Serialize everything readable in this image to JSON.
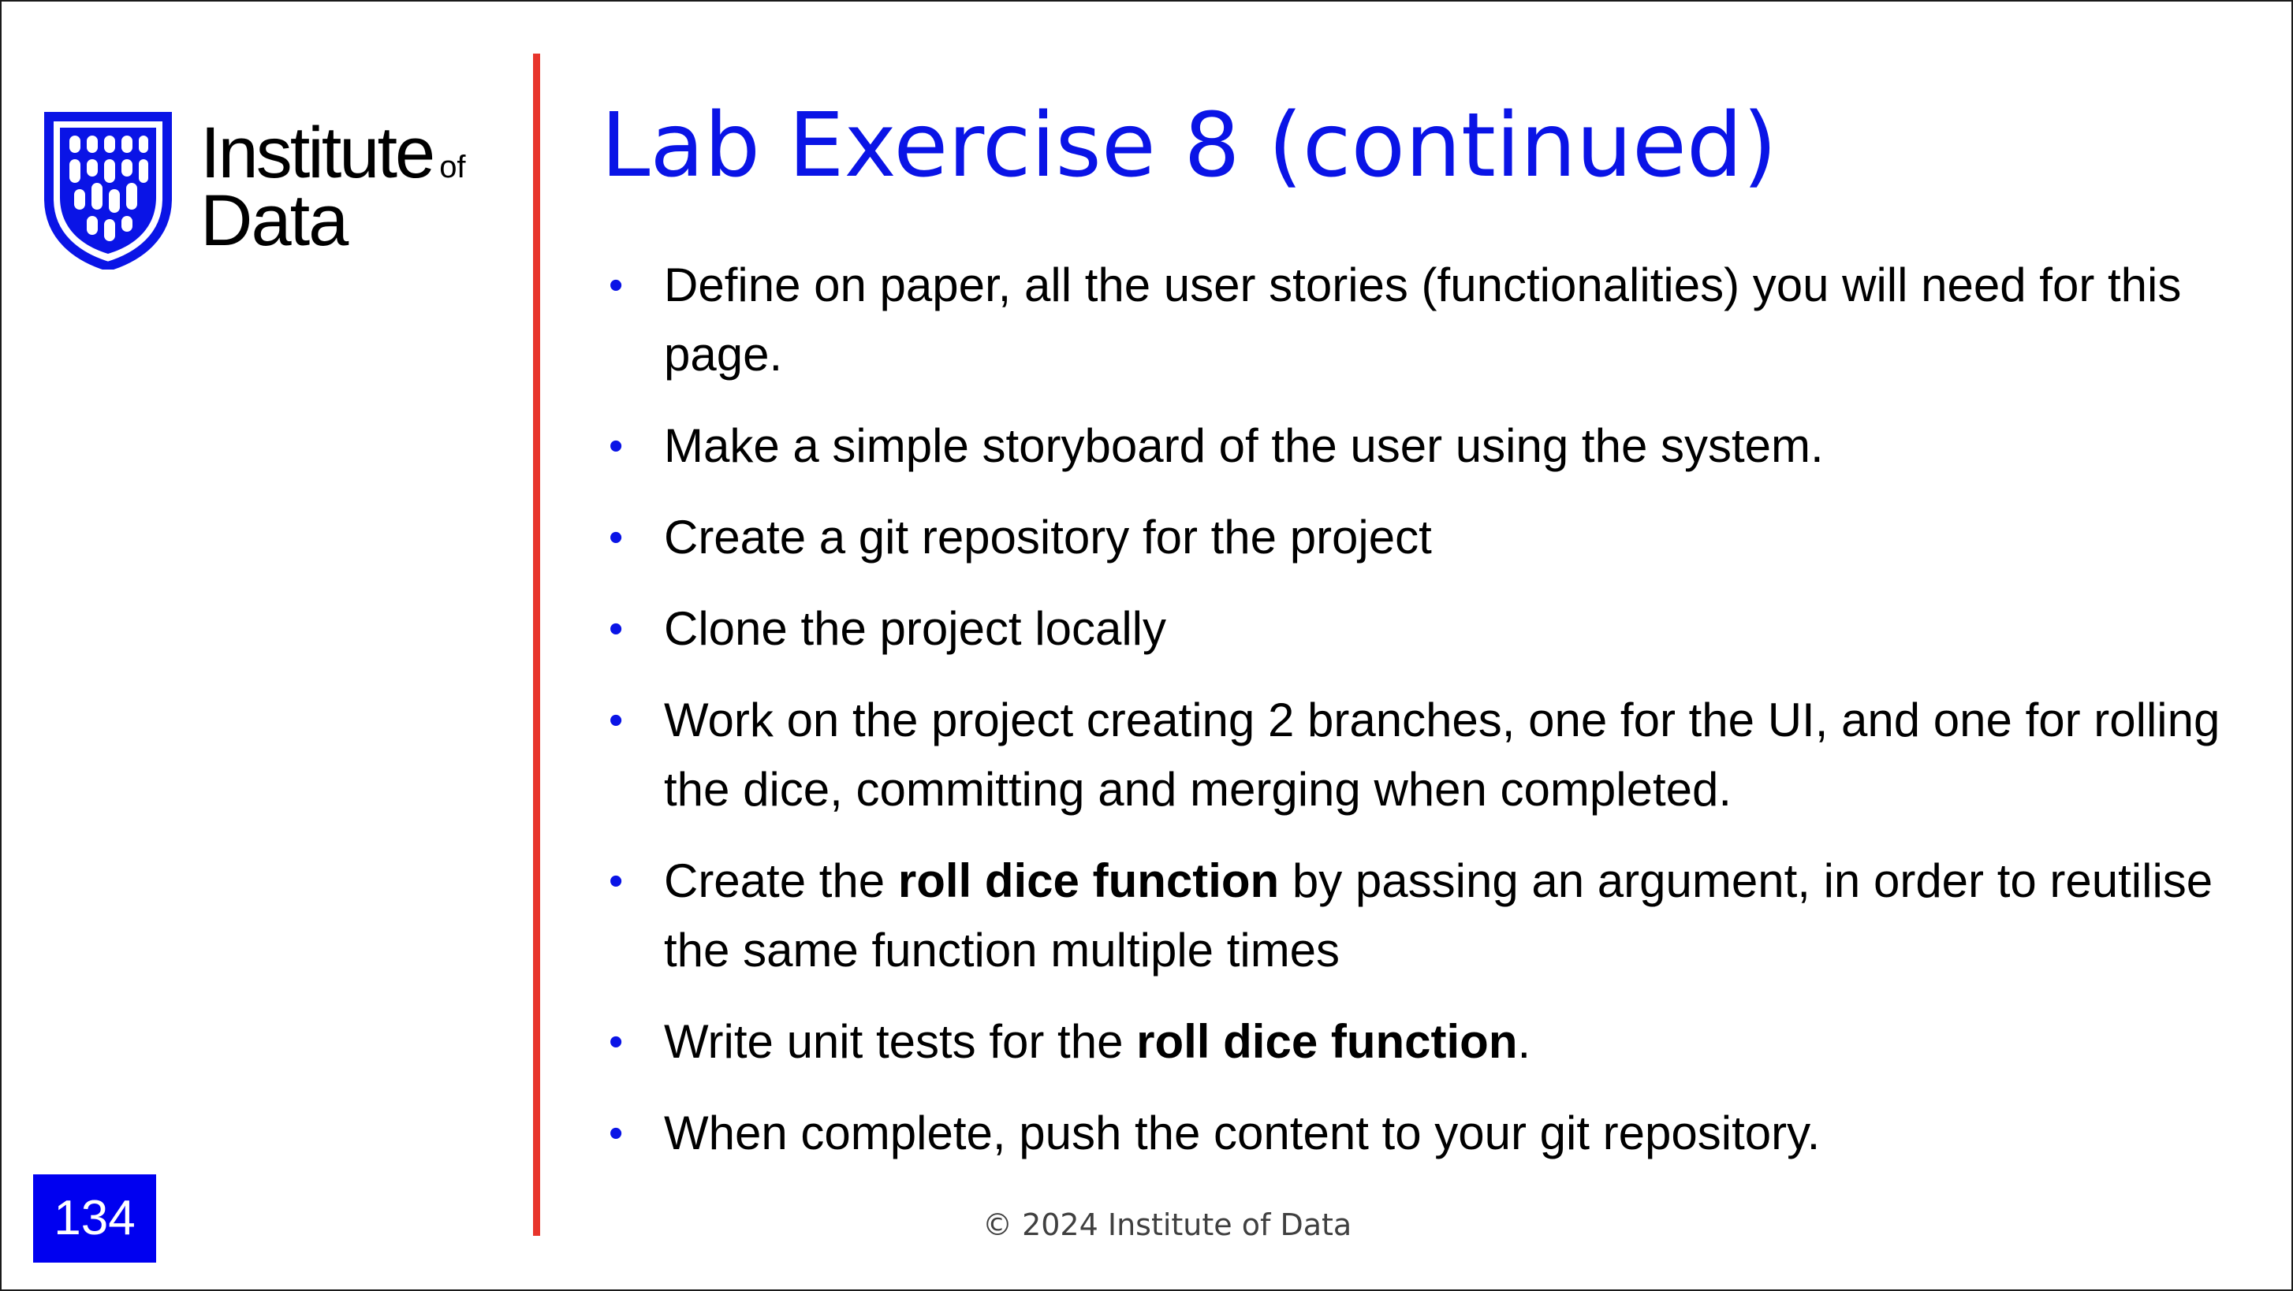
{
  "logo": {
    "line1": "Institute",
    "of": "of",
    "line2": "Data",
    "icon": "shield-logo-icon",
    "color": "#0a14e6"
  },
  "slide": {
    "title": "Lab Exercise 8 (continued)",
    "bullets": [
      {
        "parts": [
          {
            "text": "Define on paper, all the user stories (functionalities) you will need for this page.",
            "bold": false
          }
        ]
      },
      {
        "parts": [
          {
            "text": "Make a simple storyboard of the user using the system.",
            "bold": false
          }
        ]
      },
      {
        "parts": [
          {
            "text": "Create a git repository for the project",
            "bold": false
          }
        ]
      },
      {
        "parts": [
          {
            "text": "Clone the project locally",
            "bold": false
          }
        ]
      },
      {
        "parts": [
          {
            "text": "Work on the project creating 2 branches, one for the UI, and one for rolling the dice, committing and merging when completed.",
            "bold": false
          }
        ]
      },
      {
        "parts": [
          {
            "text": "Create the ",
            "bold": false
          },
          {
            "text": "roll dice function",
            "bold": true
          },
          {
            "text": " by passing an argument, in order to reutilise the same function multiple times",
            "bold": false
          }
        ]
      },
      {
        "parts": [
          {
            "text": "Write unit tests for the ",
            "bold": false
          },
          {
            "text": "roll dice function",
            "bold": true
          },
          {
            "text": ".",
            "bold": false
          }
        ]
      },
      {
        "parts": [
          {
            "text": "When complete, push the content to your git repository.",
            "bold": false
          }
        ]
      }
    ],
    "bullet_symbol": "•",
    "page_number": "134",
    "footer": "© 2024 Institute of Data"
  },
  "colors": {
    "title": "#0a14e6",
    "bullet": "#0a14e6",
    "divider": "#e8352c",
    "page_number_bg": "#0000f0"
  }
}
